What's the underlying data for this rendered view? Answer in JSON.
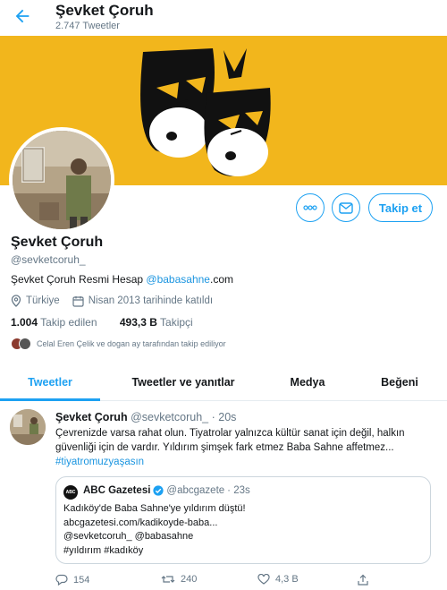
{
  "topbar": {
    "title": "Şevket Çoruh",
    "tweet_count": "2.747 Tweetler"
  },
  "profile": {
    "name": "Şevket Çoruh",
    "handle": "@sevketcoruh_",
    "bio_prefix": "Şevket Çoruh Resmi Hesap ",
    "bio_link": "@babasahne",
    "bio_suffix": ".com",
    "location": "Türkiye",
    "joined": "Nisan 2013 tarihinde katıldı",
    "following_count": "1.004",
    "following_label": "Takip edilen",
    "followers_count": "493,3 B",
    "followers_label": "Takipçi",
    "followed_by": "Celal Eren Çelik ve dogan ay tarafından takip ediliyor",
    "follow_button": "Takip et",
    "accent_color": "#1da1f2",
    "banner_color": "#f2b61c"
  },
  "tabs": [
    {
      "label": "Tweetler"
    },
    {
      "label": "Tweetler ve yanıtlar"
    },
    {
      "label": "Medya"
    },
    {
      "label": "Beğeni"
    }
  ],
  "tweet": {
    "name": "Şevket Çoruh",
    "handle": "@sevketcoruh_",
    "time": "· 20s",
    "text_line1": "Çevrenizde varsa rahat olun. Tiyatrolar yalnızca kültür sanat için değil, halkın",
    "text_line2": "güvenliği için de vardır. Yıldırım şimşek fark etmez Baba Sahne affetmez...",
    "hashtag": "#tiyatromuzyaşasın",
    "quote": {
      "logo_text": "ABC",
      "name": "ABC Gazetesi",
      "handle": "@abcgazete",
      "time": "· 23s",
      "line1": "Kadıköy'de Baba Sahne'ye yıldırım düştü!",
      "line2": "abcgazetesi.com/kadikoyde-baba...",
      "line3": "@sevketcoruh_ @babasahne",
      "line4": "#yıldırım #kadıköy"
    },
    "replies": "154",
    "retweets": "240",
    "likes": "4,3 B"
  }
}
